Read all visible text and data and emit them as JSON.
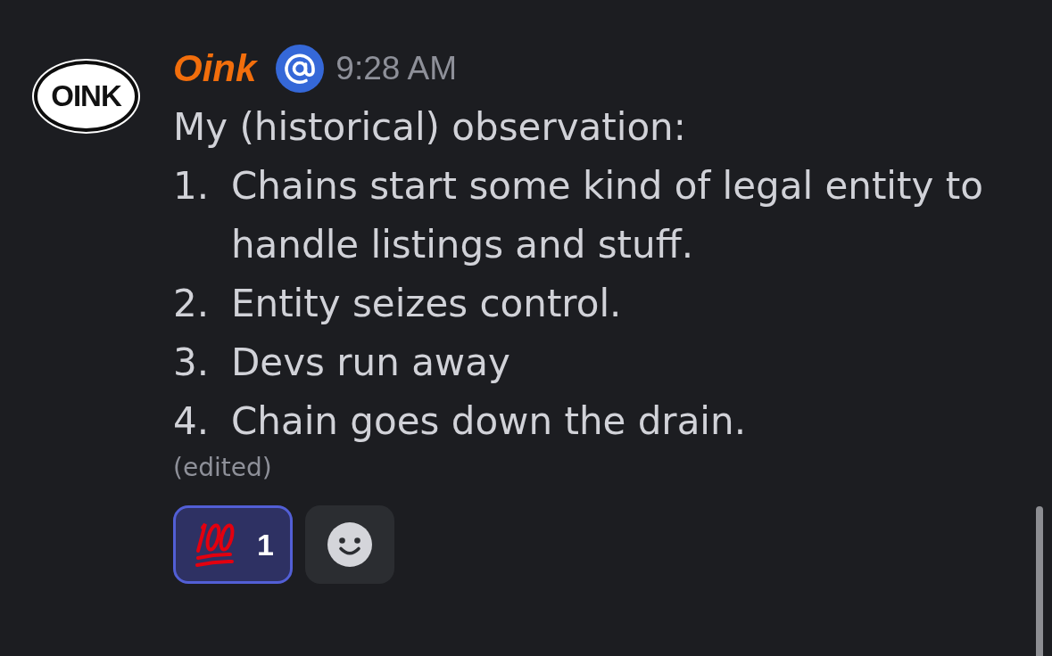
{
  "message": {
    "avatar": {
      "text": "OINK"
    },
    "author": "Oink",
    "timestamp": "9:28 AM",
    "intro": "My (historical) observation:",
    "steps": [
      {
        "number": "1.",
        "text": "Chains start some kind of legal entity to handle listings and stuff."
      },
      {
        "number": "2.",
        "text": "Entity seizes control."
      },
      {
        "number": "3.",
        "text": "Devs run away"
      },
      {
        "number": "4.",
        "text": "Chain goes down the drain."
      }
    ],
    "edited": "(edited)",
    "reactions": [
      {
        "count": "1",
        "selected": true
      }
    ]
  }
}
